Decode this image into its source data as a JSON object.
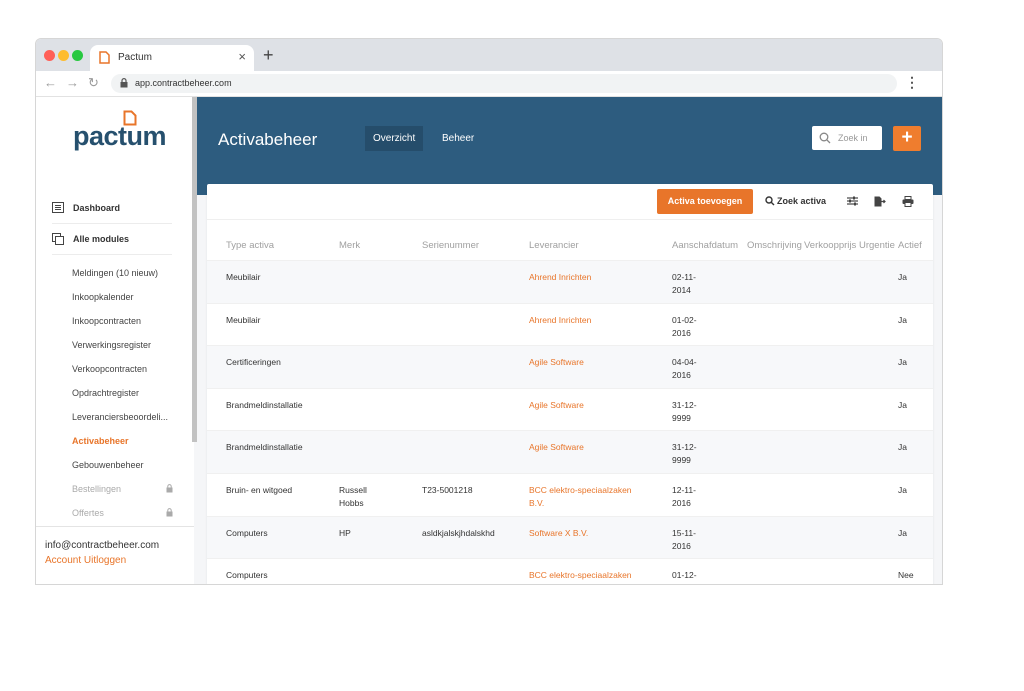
{
  "browser": {
    "tab_title": "Pactum",
    "url": "app.contractbeheer.com"
  },
  "sidebar": {
    "logo": "pactum",
    "main_items": [
      {
        "label": "Dashboard",
        "icon": "dashboard-icon"
      },
      {
        "label": "Alle modules",
        "icon": "modules-icon"
      }
    ],
    "sub_items": [
      {
        "label": "Meldingen (10 nieuw)",
        "state": "normal"
      },
      {
        "label": "Inkoopkalender",
        "state": "normal"
      },
      {
        "label": "Inkoopcontracten",
        "state": "normal"
      },
      {
        "label": "Verwerkingsregister",
        "state": "normal"
      },
      {
        "label": "Verkoopcontracten",
        "state": "normal"
      },
      {
        "label": "Opdrachtregister",
        "state": "normal"
      },
      {
        "label": "Leveranciersbeoordeli...",
        "state": "normal"
      },
      {
        "label": "Activabeheer",
        "state": "active"
      },
      {
        "label": "Gebouwenbeheer",
        "state": "normal"
      },
      {
        "label": "Bestellingen",
        "state": "locked"
      },
      {
        "label": "Offertes",
        "state": "locked"
      }
    ],
    "footer": {
      "email": "info@contractbeheer.com",
      "logout": "Account Uitloggen"
    }
  },
  "header": {
    "title": "Activabeheer",
    "tabs": [
      {
        "label": "Overzicht",
        "active": true
      },
      {
        "label": "Beheer",
        "active": false
      }
    ],
    "search_placeholder": "Zoek in",
    "add_label": "+"
  },
  "toolbar": {
    "add_label": "Activa toevoegen",
    "find_label": "Zoek activa"
  },
  "table": {
    "columns": [
      "Type activa",
      "Merk",
      "Serienummer",
      "Leverancier",
      "Aanschafdatum",
      "Omschrijving",
      "Verkoopprijs",
      "Urgentie",
      "Actief"
    ],
    "rows": [
      {
        "type": "Meubilair",
        "merk": "",
        "serie": "",
        "leverancier": "Ahrend Inrichten",
        "datum": "02-11-\n2014",
        "actief": "Ja"
      },
      {
        "type": "Meubilair",
        "merk": "",
        "serie": "",
        "leverancier": "Ahrend Inrichten",
        "datum": "01-02-\n2016",
        "actief": "Ja"
      },
      {
        "type": "Certificeringen",
        "merk": "",
        "serie": "",
        "leverancier": "Agile Software",
        "datum": "04-04-\n2016",
        "actief": "Ja"
      },
      {
        "type": "Brandmeldinstallatie",
        "merk": "",
        "serie": "",
        "leverancier": "Agile Software",
        "datum": "31-12-\n9999",
        "actief": "Ja"
      },
      {
        "type": "Brandmeldinstallatie",
        "merk": "",
        "serie": "",
        "leverancier": "Agile Software",
        "datum": "31-12-\n9999",
        "actief": "Ja"
      },
      {
        "type": "Bruin- en witgoed",
        "merk": "Russell\nHobbs",
        "serie": "T23-5001218",
        "leverancier": "BCC elektro-speciaalzaken\nB.V.",
        "datum": "12-11-\n2016",
        "actief": "Ja"
      },
      {
        "type": "Computers",
        "merk": "HP",
        "serie": "asldkjalskjhdalskhd",
        "leverancier": "Software X B.V.",
        "datum": "15-11-\n2016",
        "actief": "Ja"
      },
      {
        "type": "Computers",
        "merk": "",
        "serie": "",
        "leverancier": "BCC elektro-speciaalzaken",
        "datum": "01-12-",
        "actief": "Nee"
      }
    ]
  },
  "colors": {
    "accent": "#e8752a",
    "header_bg": "#2d5c7f",
    "logo": "#26506e"
  }
}
